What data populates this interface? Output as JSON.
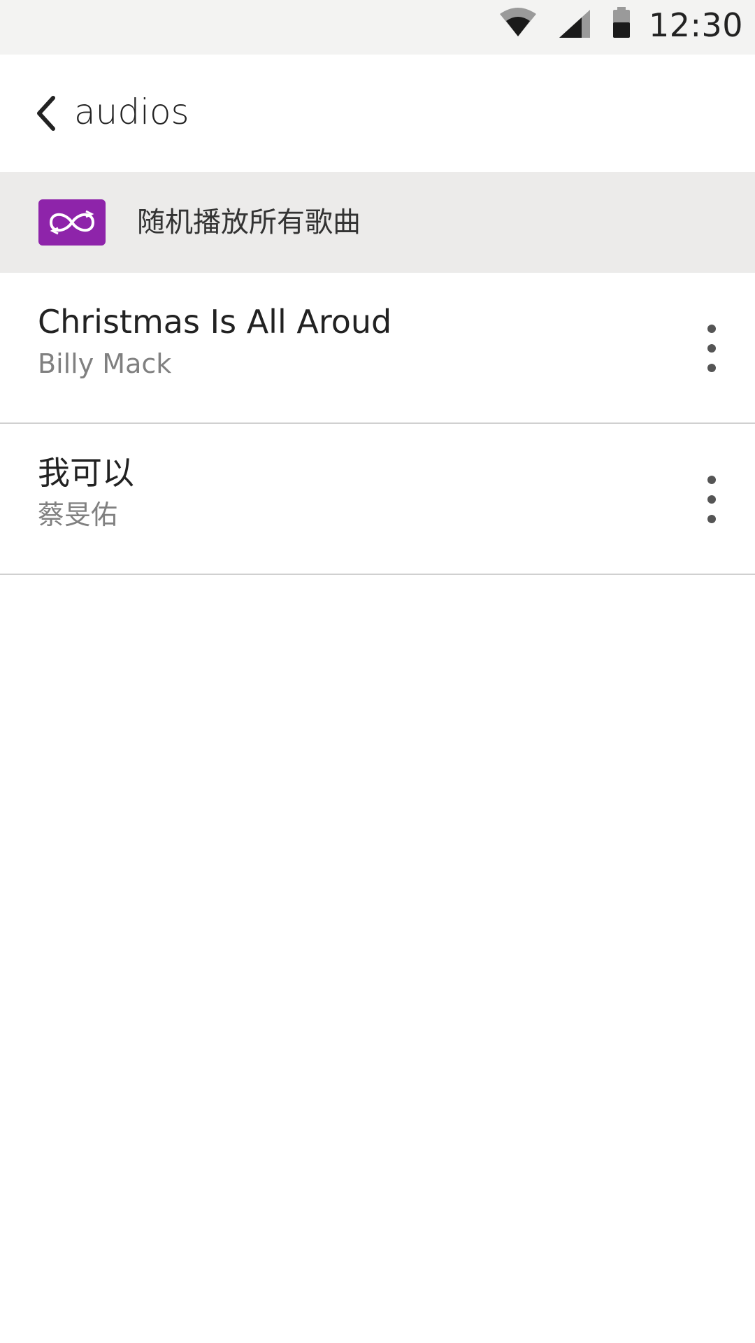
{
  "status_bar": {
    "time": "12:30",
    "icons": [
      "wifi-icon",
      "cell-signal-icon",
      "battery-icon"
    ]
  },
  "app_bar": {
    "back_icon": "chevron-left-icon",
    "title": "audios"
  },
  "shuffle": {
    "icon": "shuffle-infinity-icon",
    "label": "随机播放所有歌曲",
    "accent_color": "#8e24aa"
  },
  "songs": [
    {
      "title": "Christmas Is All Aroud",
      "artist": "Billy Mack",
      "menu_icon": "more-vertical-icon"
    },
    {
      "title": "我可以",
      "artist": "蔡旻佑",
      "menu_icon": "more-vertical-icon"
    }
  ]
}
